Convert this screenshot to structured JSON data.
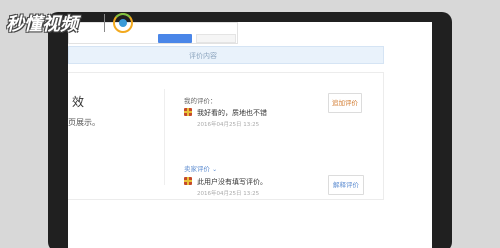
{
  "watermark": {
    "brand_text": "秒懂视频",
    "icon": "sprout-logo-icon"
  },
  "page": {
    "banner_text": "评价内容",
    "left_title": "效",
    "left_subtitle": "页展示。"
  },
  "my_review": {
    "label": "我的评价：",
    "text": "我好看的，质地也不错",
    "timestamp": "2016年04月25日 13:25",
    "action_label": "追加评价"
  },
  "seller_review": {
    "label": "卖家评价",
    "text": "此用户没有填写评价。",
    "timestamp": "2016年04月25日 13:25",
    "action_label": "解释评价"
  },
  "colors": {
    "accent_blue": "#5b8bd0",
    "accent_orange": "#d27a2e"
  }
}
